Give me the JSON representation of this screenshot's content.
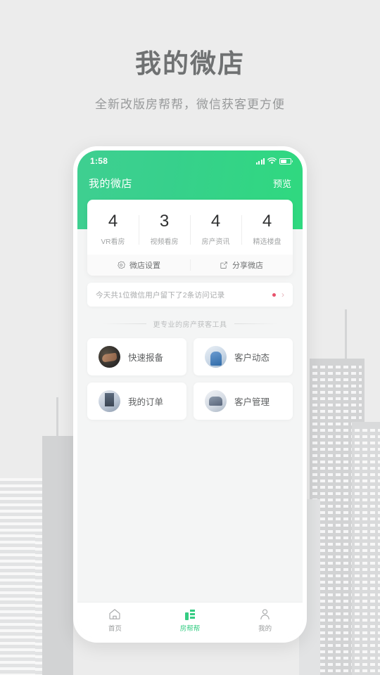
{
  "page": {
    "title": "我的微店",
    "subtitle": "全新改版房帮帮，微信获客更方便"
  },
  "phone": {
    "status_bar": {
      "time": "1:58",
      "signal_icon": "signal-bars-icon",
      "wifi_icon": "wifi-icon",
      "battery_icon": "battery-icon"
    },
    "navbar": {
      "title": "我的微店",
      "action": "预览"
    },
    "stats": [
      {
        "value": "4",
        "label": "VR看房"
      },
      {
        "value": "3",
        "label": "视频看房"
      },
      {
        "value": "4",
        "label": "房产资讯"
      },
      {
        "value": "4",
        "label": "精选楼盘"
      }
    ],
    "actions": [
      {
        "label": "微店设置",
        "icon": "gear-icon"
      },
      {
        "label": "分享微店",
        "icon": "share-icon"
      }
    ],
    "notice": {
      "text": "今天共1位微信用户留下了2条访问记录",
      "badge": "dot",
      "chevron": "›"
    },
    "section_divider": "更专业的房产获客工具",
    "tools": [
      {
        "label": "快速报备",
        "icon": "handshake-photo-icon"
      },
      {
        "label": "客户动态",
        "icon": "customer-activity-photo-icon"
      },
      {
        "label": "我的订单",
        "icon": "order-photo-icon"
      },
      {
        "label": "客户管理",
        "icon": "customer-management-photo-icon"
      }
    ],
    "tabs": [
      {
        "label": "首页",
        "icon": "home-icon",
        "active": false
      },
      {
        "label": "房帮帮",
        "icon": "building-icon",
        "active": true
      },
      {
        "label": "我的",
        "icon": "person-icon",
        "active": false
      }
    ]
  },
  "colors": {
    "brand_green": "#35cc83",
    "header_gradient_from": "#3fcf91",
    "header_gradient_to": "#2fd97f",
    "page_background": "#ececec",
    "badge_red": "#e8536c",
    "title_gray": "#6f7172"
  }
}
